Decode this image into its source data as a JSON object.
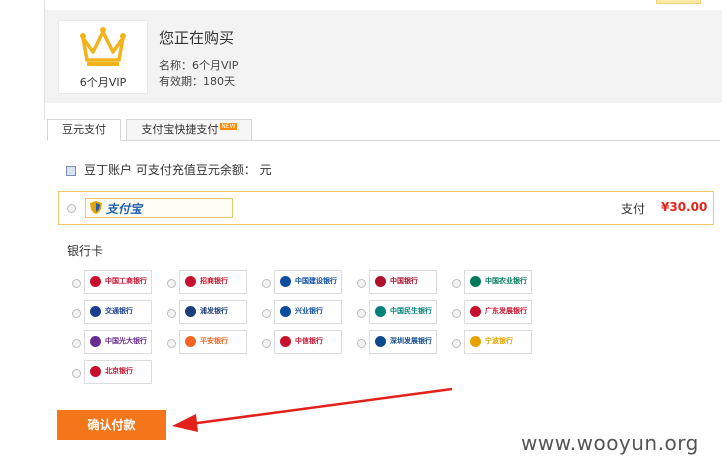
{
  "product": {
    "thumb_caption": "6个月VIP",
    "title": "您正在购买",
    "name_line": "名称：6个月VIP",
    "validity_line": "有效期：180天"
  },
  "tabs": [
    {
      "label": "豆元支付"
    },
    {
      "label": "支付宝快捷支付",
      "badge": "NEW"
    }
  ],
  "balance": {
    "text": "豆丁账户        可支付充值豆元余额：         元"
  },
  "alipay": {
    "logo_text": "支付宝",
    "pay_label": "支付",
    "amount": "¥30.00"
  },
  "bank_section_title": "银行卡",
  "banks": [
    {
      "name": "中国工商银行",
      "color": "#c8102e"
    },
    {
      "name": "招商银行",
      "color": "#c8102e"
    },
    {
      "name": "中国建设银行",
      "color": "#0c4da2"
    },
    {
      "name": "中国银行",
      "color": "#b10f2e"
    },
    {
      "name": "中国农业银行",
      "color": "#007a5a"
    },
    {
      "name": "交通银行",
      "color": "#1b3d8f"
    },
    {
      "name": "浦发银行",
      "color": "#1a3e7a"
    },
    {
      "name": "兴业银行",
      "color": "#0a4d9e"
    },
    {
      "name": "中国民生银行",
      "color": "#00837b"
    },
    {
      "name": "广东发展银行",
      "color": "#c8102e"
    },
    {
      "name": "中国光大银行",
      "color": "#6a2c91"
    },
    {
      "name": "平安银行",
      "color": "#f26522"
    },
    {
      "name": "中信银行",
      "color": "#c8102e"
    },
    {
      "name": "深圳发展银行",
      "color": "#0d4a8c"
    },
    {
      "name": "宁波银行",
      "color": "#e8a200"
    },
    {
      "name": "北京银行",
      "color": "#c8102e"
    }
  ],
  "confirm_button": "确认付款",
  "watermark": "www.wooyun.org",
  "colors": {
    "accent_orange": "#f5761a",
    "price_red": "#e1251b",
    "crown_gold": "#f3b31b"
  }
}
